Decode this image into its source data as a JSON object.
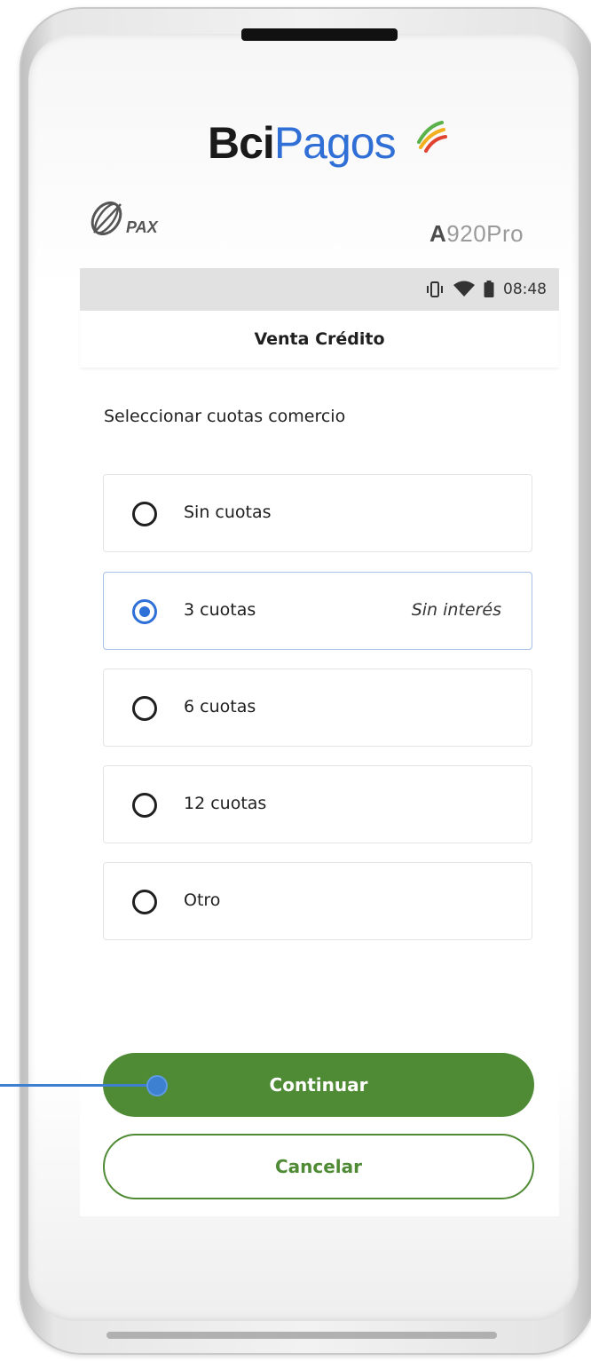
{
  "brand": {
    "part1": "Bci",
    "part2": "Pagos"
  },
  "device": {
    "maker_logo": "pax-logo",
    "model_bold": "A",
    "model_rest": "920Pro"
  },
  "statusbar": {
    "time": "08:48",
    "icons": [
      "vibrate-icon",
      "wifi-icon",
      "battery-icon"
    ]
  },
  "screen": {
    "title": "Venta Crédito",
    "section_label": "Seleccionar cuotas comercio",
    "options": [
      {
        "label": "Sin cuotas",
        "note": "",
        "selected": false
      },
      {
        "label": "3 cuotas",
        "note": "Sin interés",
        "selected": true
      },
      {
        "label": "6 cuotas",
        "note": "",
        "selected": false
      },
      {
        "label": "12 cuotas",
        "note": "",
        "selected": false
      },
      {
        "label": "Otro",
        "note": "",
        "selected": false
      }
    ],
    "continue_label": "Continuar",
    "cancel_label": "Cancelar"
  },
  "colors": {
    "primary_green": "#4f8a35",
    "radio_blue": "#2e6fd8",
    "brand_blue": "#2f6fd6",
    "pointer_blue": "#3d7fd0"
  }
}
